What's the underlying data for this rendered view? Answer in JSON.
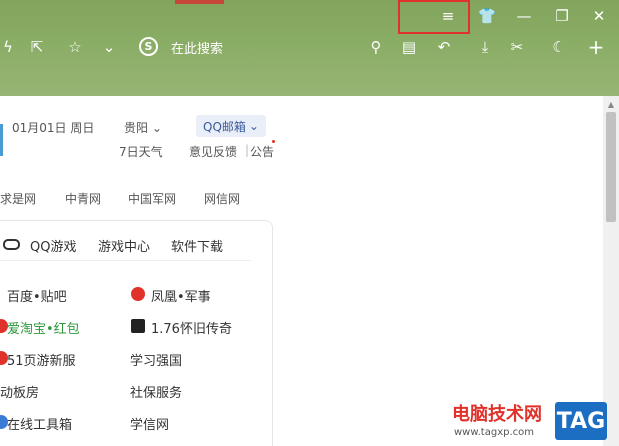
{
  "window": {
    "menu_icon": "≡",
    "skin_icon": "👕",
    "minimize_icon": "—",
    "restore_icon": "❐",
    "close_icon": "✕"
  },
  "toolbar": {
    "search_logo": "S",
    "search_placeholder": "在此搜索",
    "icons": {
      "lightning": "ϟ",
      "share": "⇱",
      "star": "☆",
      "chevron": "⌄",
      "search": "⚲",
      "notes": "▤",
      "undo": "↶",
      "download": "⤓",
      "scissors": "✂",
      "night": "☾",
      "add": "+"
    }
  },
  "home": {
    "date": "01月01日 周日",
    "city": "贵阳",
    "city_chevron": "⌄",
    "weather": "7日天气",
    "mailbox": "QQ邮箱",
    "mailbox_chevron": "⌄",
    "feedback": "意见反馈",
    "separator": "|",
    "notice": "公告"
  },
  "news_links": [
    "求是网",
    "中青网",
    "中国军网",
    "网信网"
  ],
  "card": {
    "header": [
      "QQ游戏",
      "游戏中心",
      "软件下载"
    ],
    "left_sites": [
      {
        "label": "百度•贴吧"
      },
      {
        "label": "爱淘宝•红包"
      },
      {
        "label": "51页游新服"
      },
      {
        "label": "动板房"
      },
      {
        "label": "在线工具箱"
      }
    ],
    "right_sites": [
      {
        "label": "凤凰•军事"
      },
      {
        "label": "1.76怀旧传奇"
      },
      {
        "label": "学习强国"
      },
      {
        "label": "社保服务"
      },
      {
        "label": "学信网"
      }
    ]
  },
  "colors": {
    "topbar": "#8aad66",
    "highlight_border": "#e0312a",
    "mailbox_bg": "#e9eef8",
    "green_text": "#2f9a3c"
  },
  "watermark": {
    "main": "电脑技术网",
    "url": "www.tagxp.com",
    "tag": "TAG"
  }
}
